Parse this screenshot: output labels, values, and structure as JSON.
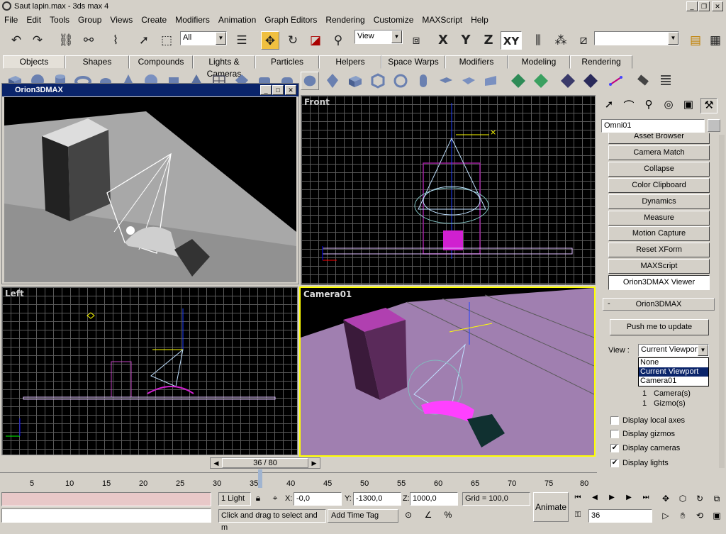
{
  "title": "Saut lapin.max - 3ds max 4",
  "menu": [
    "File",
    "Edit",
    "Tools",
    "Group",
    "Views",
    "Create",
    "Modifiers",
    "Animation",
    "Graph Editors",
    "Rendering",
    "Customize",
    "MAXScript",
    "Help"
  ],
  "toolbar": {
    "selection_filter": "All",
    "ref_coord": "View",
    "axis_x": "X",
    "axis_y": "Y",
    "axis_z": "Z",
    "axis_xy": "XY"
  },
  "tabs": [
    "Objects",
    "Shapes",
    "Compounds",
    "Lights & Cameras",
    "Particles",
    "Helpers",
    "Space Warps",
    "Modifiers",
    "Modeling",
    "Rendering"
  ],
  "orion_window": {
    "title": "Orion3DMAX"
  },
  "viewports": {
    "front": "Front",
    "left": "Left",
    "camera": "Camera01"
  },
  "command_panel": {
    "object_name": "Omni01",
    "utility_buttons": [
      "Asset Browser",
      "Camera Match",
      "Collapse",
      "Color Clipboard",
      "Dynamics",
      "Measure",
      "Motion Capture",
      "Reset XForm",
      "MAXScript",
      "Orion3DMAX Viewer"
    ],
    "rollout_title": "Orion3DMAX",
    "rollout_minus": "-",
    "push_button": "Push me to update",
    "view_label": "View :",
    "view_selected": "Current Viewport",
    "view_options": [
      "None",
      "Current Viewport",
      "Camera01"
    ],
    "counts": [
      {
        "n": "1",
        "label": "Camera(s)"
      },
      {
        "n": "1",
        "label": "Gizmo(s)"
      }
    ],
    "checkboxes": [
      {
        "label": "Display local axes",
        "checked": false
      },
      {
        "label": "Display gizmos",
        "checked": false
      },
      {
        "label": "Display cameras",
        "checked": true
      },
      {
        "label": "Display lights",
        "checked": true
      }
    ]
  },
  "timeslider": {
    "label": "36 / 80",
    "ticks": [
      "5",
      "10",
      "15",
      "20",
      "25",
      "30",
      "35",
      "40",
      "45",
      "50",
      "55",
      "60",
      "65",
      "70",
      "75",
      "80"
    ]
  },
  "status": {
    "selection": "1 Light",
    "x_label": "X:",
    "x_val": "-0,0",
    "y_label": "Y:",
    "y_val": "-1300,0",
    "z_label": "Z:",
    "z_val": "1000,0",
    "grid": "Grid = 100,0",
    "prompt": "Click and drag to select and m",
    "add_time_tag": "Add Time Tag",
    "animate": "Animate",
    "frame": "36"
  },
  "colors": {
    "title_bg": "#0a246a",
    "highlight": "#0a246a",
    "viewport_active": "#ffff00"
  }
}
